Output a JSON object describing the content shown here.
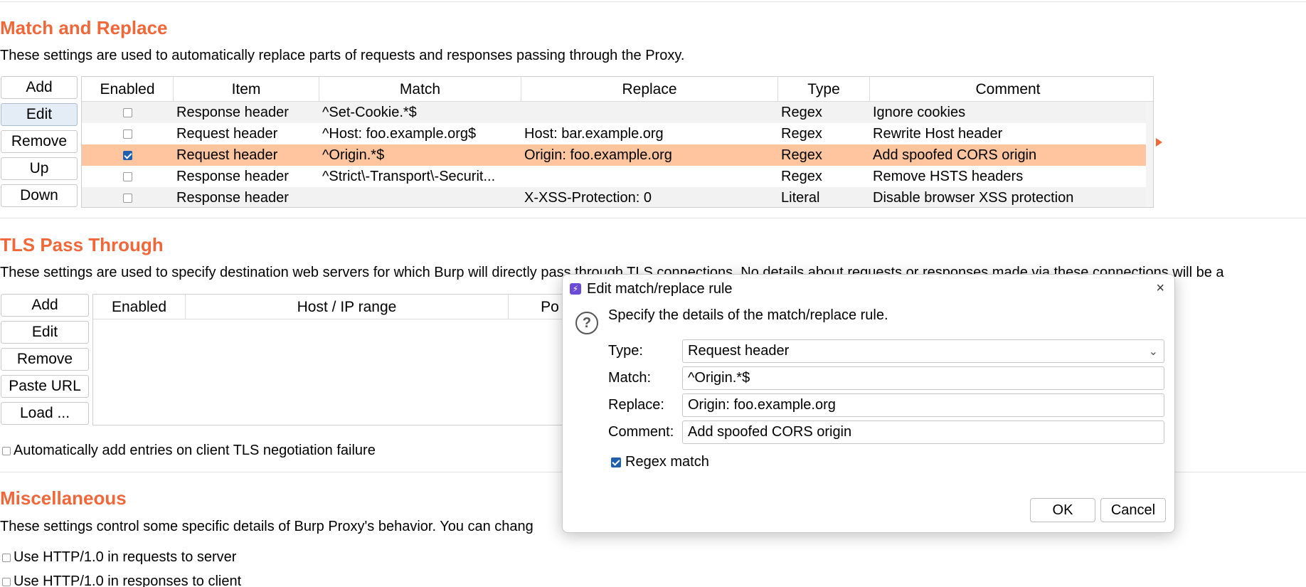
{
  "match_replace": {
    "title": "Match and Replace",
    "description": "These settings are used to automatically replace parts of requests and responses passing through the Proxy.",
    "buttons": {
      "add": "Add",
      "edit": "Edit",
      "remove": "Remove",
      "up": "Up",
      "down": "Down"
    },
    "columns": [
      "Enabled",
      "Item",
      "Match",
      "Replace",
      "Type",
      "Comment"
    ],
    "rows": [
      {
        "enabled": false,
        "item": "Response header",
        "match": "^Set-Cookie.*$",
        "replace": "",
        "type": "Regex",
        "comment": "Ignore cookies"
      },
      {
        "enabled": false,
        "item": "Request header",
        "match": "^Host: foo.example.org$",
        "replace": "Host: bar.example.org",
        "type": "Regex",
        "comment": "Rewrite Host header"
      },
      {
        "enabled": true,
        "item": "Request header",
        "match": "^Origin.*$",
        "replace": "Origin: foo.example.org",
        "type": "Regex",
        "comment": "Add spoofed CORS origin",
        "selected": true
      },
      {
        "enabled": false,
        "item": "Response header",
        "match": "^Strict\\-Transport\\-Securit...",
        "replace": "",
        "type": "Regex",
        "comment": "Remove HSTS headers"
      },
      {
        "enabled": false,
        "item": "Response header",
        "match": "",
        "replace": "X-XSS-Protection: 0",
        "type": "Literal",
        "comment": "Disable browser XSS protection"
      }
    ]
  },
  "tls": {
    "title": "TLS Pass Through",
    "description": "These settings are used to specify destination web servers for which Burp will directly pass through TLS connections. No details about requests or responses made via these connections will be a",
    "buttons": {
      "add": "Add",
      "edit": "Edit",
      "remove": "Remove",
      "paste_url": "Paste URL",
      "load": "Load ..."
    },
    "columns": [
      "Enabled",
      "Host / IP range",
      "Po"
    ],
    "auto_add_label": "Automatically add entries on client TLS negotiation failure"
  },
  "misc": {
    "title": "Miscellaneous",
    "description": "These settings control some specific details of Burp Proxy's behavior. You can chang",
    "options": [
      "Use HTTP/1.0 in requests to server",
      "Use HTTP/1.0 in responses to client"
    ]
  },
  "dialog": {
    "title": "Edit match/replace rule",
    "close": "×",
    "intro": "Specify the details of the match/replace rule.",
    "labels": {
      "type": "Type:",
      "match": "Match:",
      "replace": "Replace:",
      "comment": "Comment:"
    },
    "values": {
      "type": "Request header",
      "match": "^Origin.*$",
      "replace": "Origin: foo.example.org",
      "comment": "Add spoofed CORS origin"
    },
    "regex_label": "Regex match",
    "regex_checked": true,
    "ok": "OK",
    "cancel": "Cancel"
  },
  "colors": {
    "accent": "#f0683a",
    "selected_row": "#ffc59e",
    "checkbox": "#1f5fae"
  }
}
